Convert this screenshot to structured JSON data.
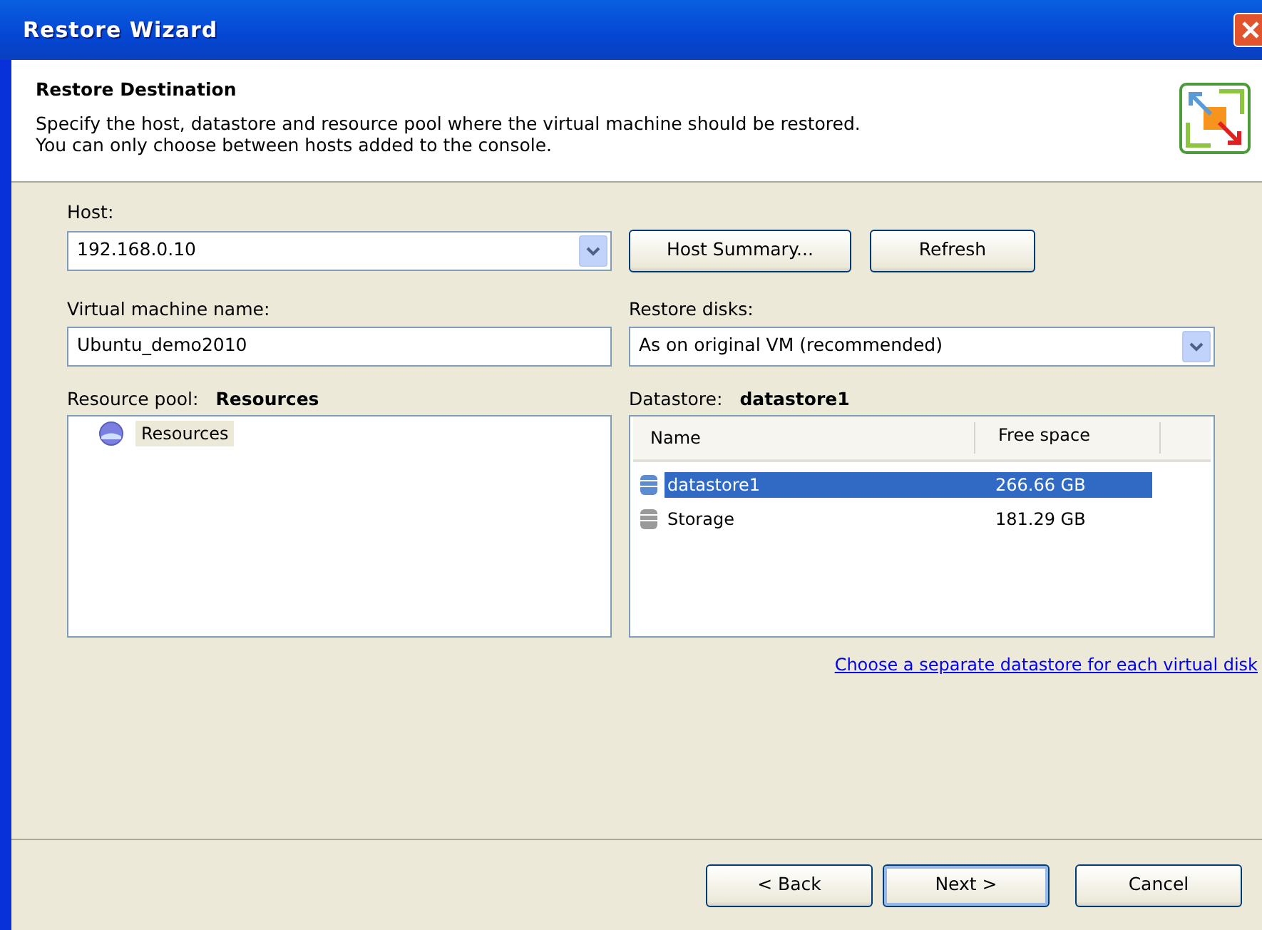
{
  "window": {
    "title": "Restore Wizard"
  },
  "header": {
    "title": "Restore Destination",
    "description": "Specify the host, datastore and resource pool where the virtual machine should be restored.\nYou can only choose between hosts added to the console."
  },
  "host": {
    "label": "Host:",
    "value": "192.168.0.10",
    "buttons": [
      "Host Summary...",
      "Refresh"
    ]
  },
  "vm_name": {
    "label": "Virtual machine name:",
    "value": "Ubuntu_demo2010"
  },
  "restore_disks": {
    "label": "Restore disks:",
    "value": "As on original VM (recommended)"
  },
  "resource_pool": {
    "label": "Resource pool:",
    "value": "Resources",
    "tree": [
      {
        "label": "Resources",
        "selected": true
      }
    ]
  },
  "datastore": {
    "label": "Datastore:",
    "value": "datastore1",
    "columns": [
      "Name",
      "Free space"
    ],
    "rows": [
      {
        "name": "datastore1",
        "free_space": "266.66 GB",
        "selected": true
      },
      {
        "name": "Storage",
        "free_space": "181.29 GB",
        "selected": false
      }
    ]
  },
  "link": "Choose a separate datastore for each virtual disk",
  "buttons": [
    {
      "label": "< Back",
      "default": false
    },
    {
      "label": "Next >",
      "default": true
    },
    {
      "label": "Cancel",
      "default": false
    }
  ]
}
